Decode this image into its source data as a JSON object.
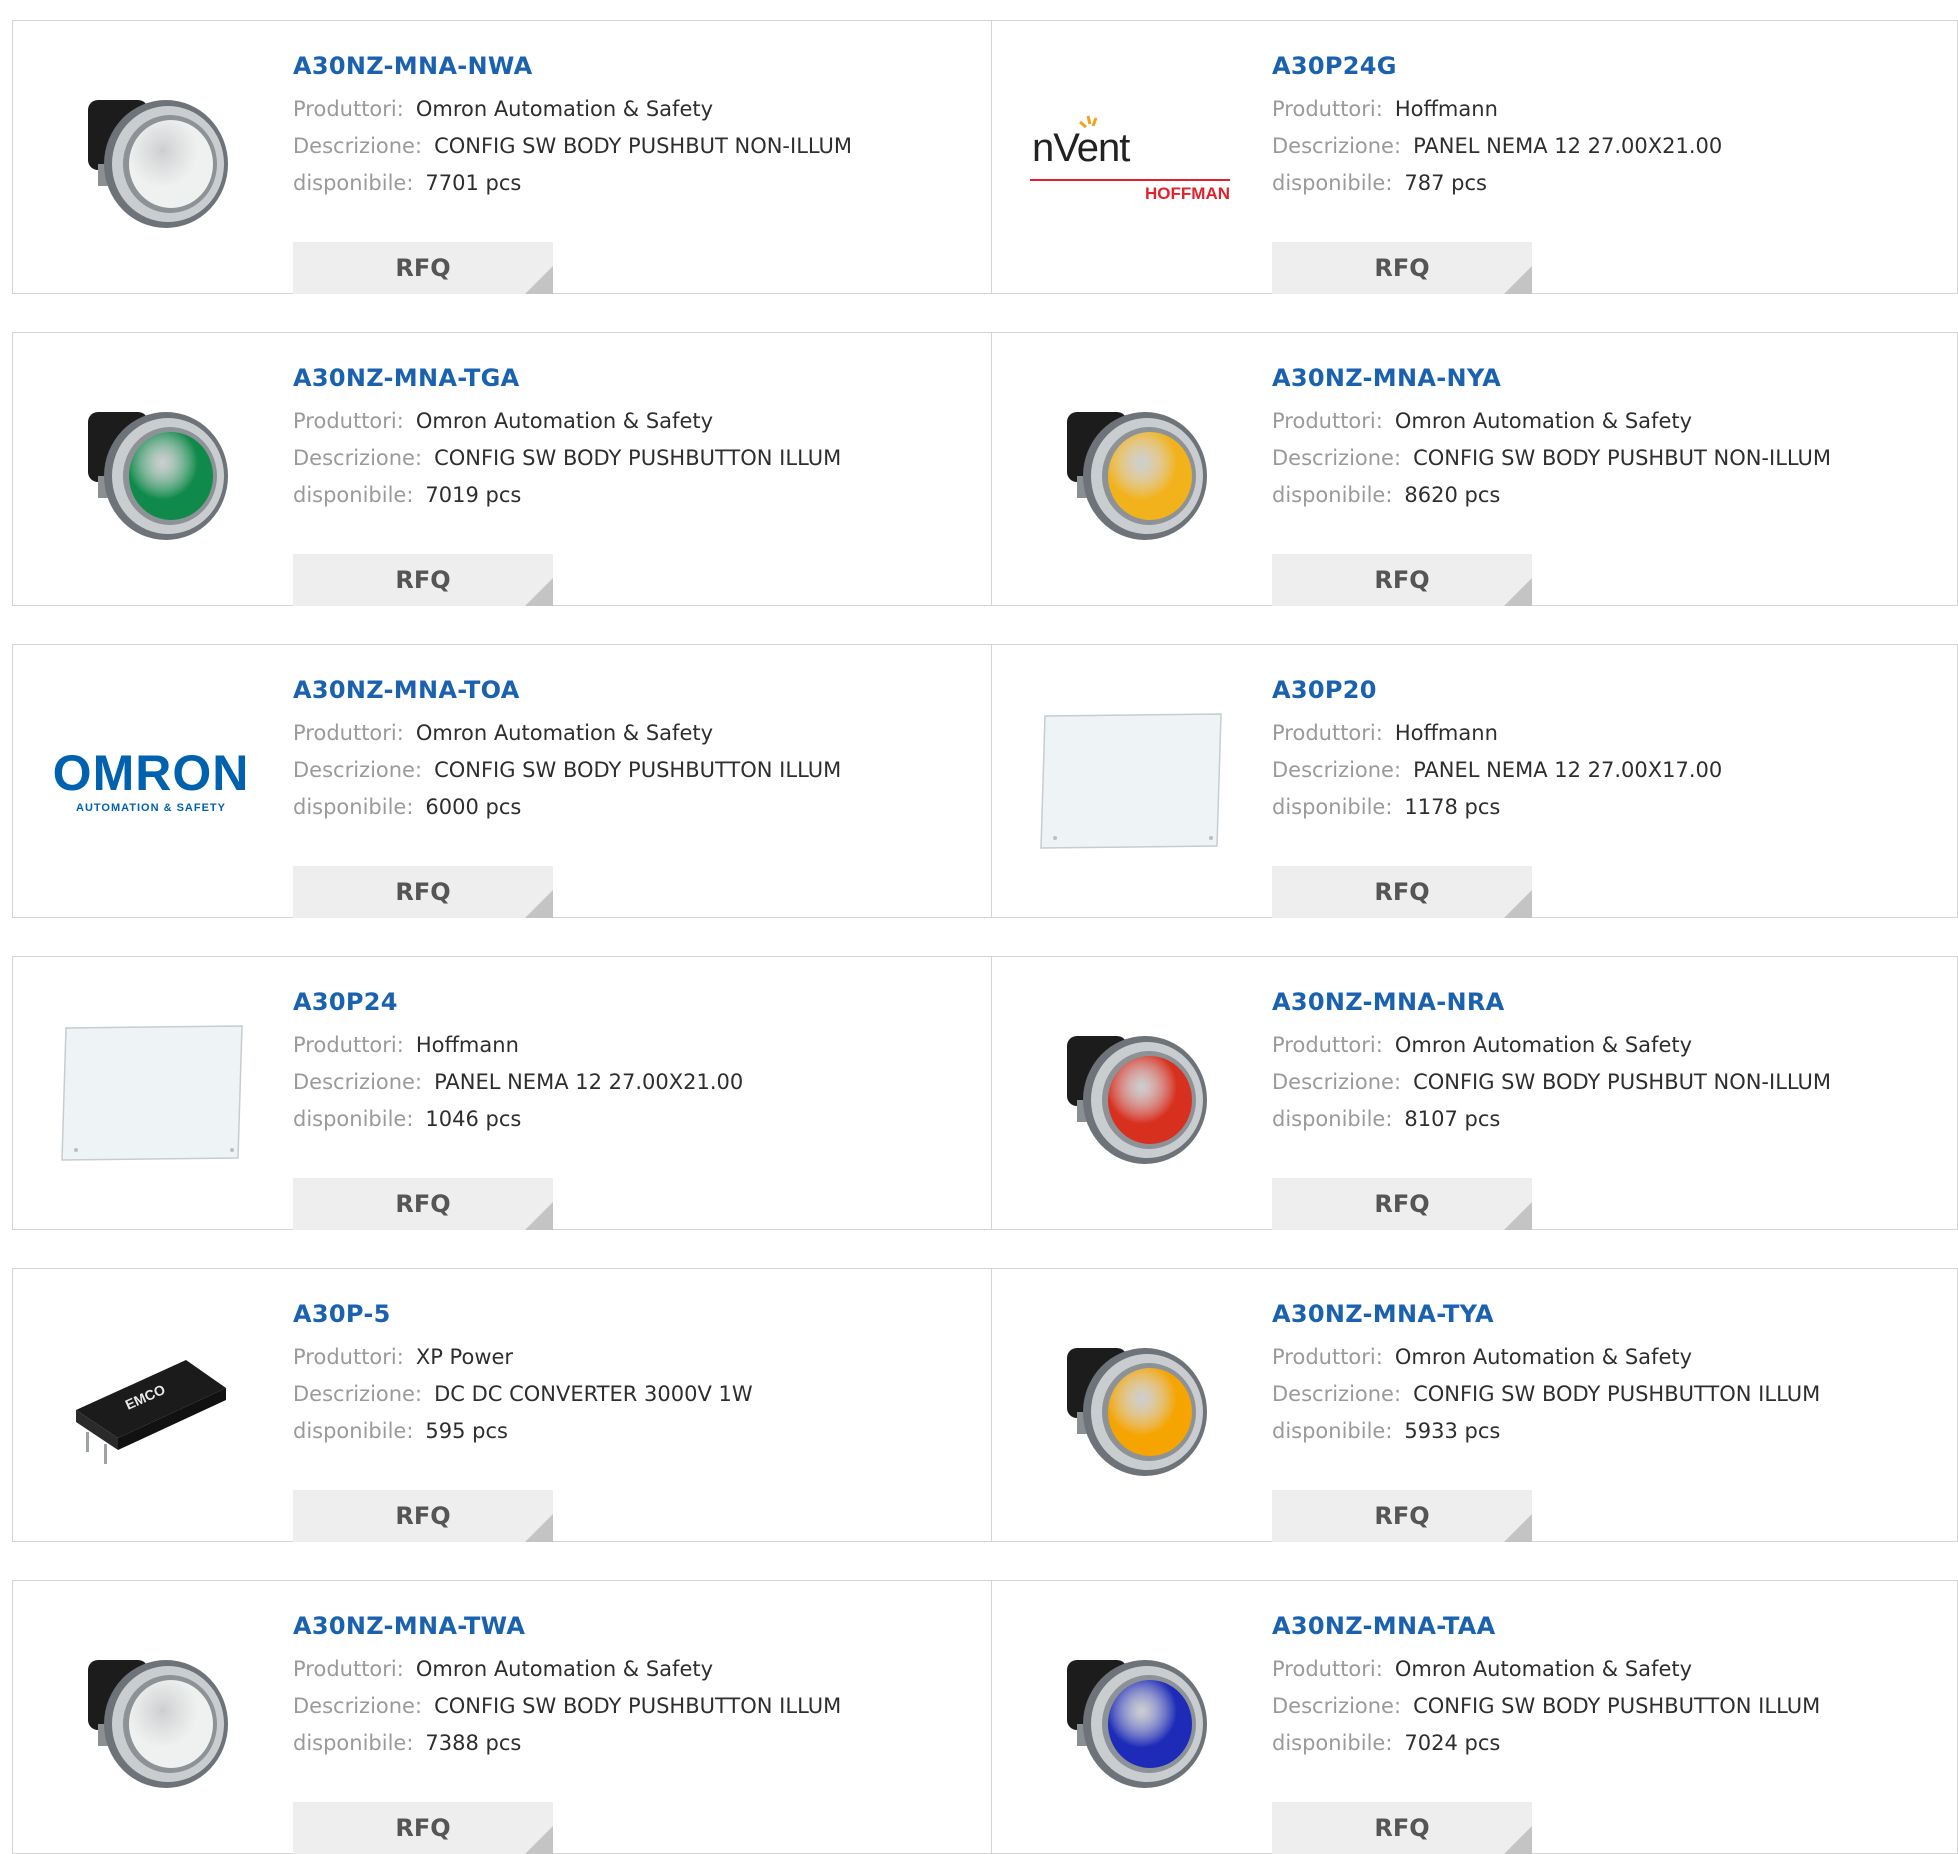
{
  "labels": {
    "manufacturer": "Produttori:",
    "description": "Descrizione:",
    "availability": "disponibile:",
    "rfq": "RFQ"
  },
  "products": [
    {
      "part": "A30NZ-MNA-NWA",
      "manufacturer": "Omron Automation & Safety",
      "description": "CONFIG SW BODY PUSHBUT NON-ILLUM",
      "stock": "7701 pcs",
      "image": "pushbutton-white-icon"
    },
    {
      "part": "A30P24G",
      "manufacturer": "Hoffmann",
      "description": "PANEL NEMA 12 27.00X21.00",
      "stock": "787 pcs",
      "image": "nvent-hoffman-logo",
      "logo_text": "nVent",
      "logo_subtext": "HOFFMAN"
    },
    {
      "part": "A30NZ-MNA-TGA",
      "manufacturer": "Omron Automation & Safety",
      "description": "CONFIG SW BODY PUSHBUTTON ILLUM",
      "stock": "7019 pcs",
      "image": "pushbutton-green-icon"
    },
    {
      "part": "A30NZ-MNA-NYA",
      "manufacturer": "Omron Automation & Safety",
      "description": "CONFIG SW BODY PUSHBUT NON-ILLUM",
      "stock": "8620 pcs",
      "image": "pushbutton-yellow-icon"
    },
    {
      "part": "A30NZ-MNA-TOA",
      "manufacturer": "Omron Automation & Safety",
      "description": "CONFIG SW BODY PUSHBUTTON ILLUM",
      "stock": "6000 pcs",
      "image": "omron-logo",
      "logo_text": "OMRON",
      "logo_subtext": "AUTOMATION & SAFETY"
    },
    {
      "part": "A30P20",
      "manufacturer": "Hoffmann",
      "description": "PANEL NEMA 12 27.00X17.00",
      "stock": "1178 pcs",
      "image": "panel-plate-icon"
    },
    {
      "part": "A30P24",
      "manufacturer": "Hoffmann",
      "description": "PANEL NEMA 12 27.00X21.00",
      "stock": "1046 pcs",
      "image": "panel-plate-icon"
    },
    {
      "part": "A30NZ-MNA-NRA",
      "manufacturer": "Omron Automation & Safety",
      "description": "CONFIG SW BODY PUSHBUT NON-ILLUM",
      "stock": "8107 pcs",
      "image": "pushbutton-red-icon"
    },
    {
      "part": "A30P-5",
      "manufacturer": "XP Power",
      "description": "DC DC CONVERTER 3000V 1W",
      "stock": "595 pcs",
      "image": "dc-converter-icon"
    },
    {
      "part": "A30NZ-MNA-TYA",
      "manufacturer": "Omron Automation & Safety",
      "description": "CONFIG SW BODY PUSHBUTTON ILLUM",
      "stock": "5933 pcs",
      "image": "pushbutton-amber-icon"
    },
    {
      "part": "A30NZ-MNA-TWA",
      "manufacturer": "Omron Automation & Safety",
      "description": "CONFIG SW BODY PUSHBUTTON ILLUM",
      "stock": "7388 pcs",
      "image": "pushbutton-white-icon"
    },
    {
      "part": "A30NZ-MNA-TAA",
      "manufacturer": "Omron Automation & Safety",
      "description": "CONFIG SW BODY PUSHBUTTON ILLUM",
      "stock": "7024 pcs",
      "image": "pushbutton-blue-icon"
    }
  ],
  "colors": {
    "link": "#1a62b0",
    "label": "#9a9a9a",
    "value": "#2e2e2e",
    "border": "#d4d4d4",
    "rfq_bg": "#eeeeee",
    "rfq_corner": "#c4c4c4",
    "cap_white": "#eef1ef",
    "cap_green": "#0f8a4a",
    "cap_yellow": "#f2b21c",
    "cap_red": "#d8301f",
    "cap_amber": "#f5a400",
    "cap_blue": "#1d2bb8",
    "omron_blue": "#0061ae",
    "nvent_red": "#e4212b"
  }
}
